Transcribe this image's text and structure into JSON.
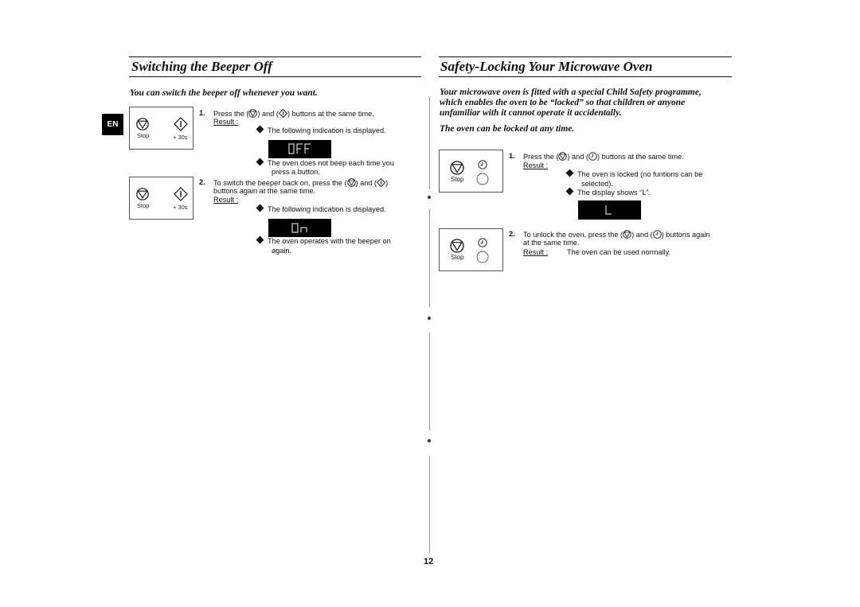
{
  "page": {
    "language_tab": "EN",
    "page_number": "12"
  },
  "left": {
    "title": "Switching the Beeper Off",
    "intro": "You can switch the beeper off whenever you want.",
    "panel": {
      "stop_label": "Stop",
      "plus30_label": "+ 30s"
    },
    "step1": {
      "number": "1.",
      "pre": "Press the (",
      "mid": ") and (",
      "post": ") buttons at the same time.",
      "result_label": "Result :",
      "bullet1": "The following indication is displayed.",
      "display": "OFF",
      "bullet2_line1": "The oven does not beep each time you",
      "bullet2_line2": "press a button."
    },
    "step2": {
      "number": "2.",
      "line1_pre": "To switch the beeper back on, press the (",
      "line1_mid": ") and (",
      "line1_post": ")",
      "line2": "buttons again at the same time.",
      "result_label": "Result :",
      "bullet1": "The following indication is displayed.",
      "display": "On",
      "bullet2_line1": "The oven operates with the beeper on",
      "bullet2_line2": "again."
    }
  },
  "right": {
    "title": "Safety-Locking Your Microwave Oven",
    "intro_lines": [
      "Your microwave oven is fitted with a special Child Safety programme,",
      "which enables the oven to be “locked” so that children or anyone",
      "unfamiliar with it cannot operate it accidentally."
    ],
    "intro2": "The oven can be locked at any time.",
    "panel": {
      "stop_label": "Stop"
    },
    "step1": {
      "number": "1.",
      "pre": "Press the (",
      "mid": ") and (",
      "post": ") buttons at the same time.",
      "result_label": "Result :",
      "bullet1_line1": "The oven is locked (no funtions can be",
      "bullet1_line2": "selected).",
      "bullet2": "The display shows “L”.",
      "display": "L"
    },
    "step2": {
      "number": "2.",
      "line1_pre": "To unlock the oven, press the (",
      "line1_mid": ") and (",
      "line1_post": ") buttons again",
      "line2": "at the same time.",
      "result_label": "Result :",
      "result_text": "The oven can be used normally."
    }
  }
}
